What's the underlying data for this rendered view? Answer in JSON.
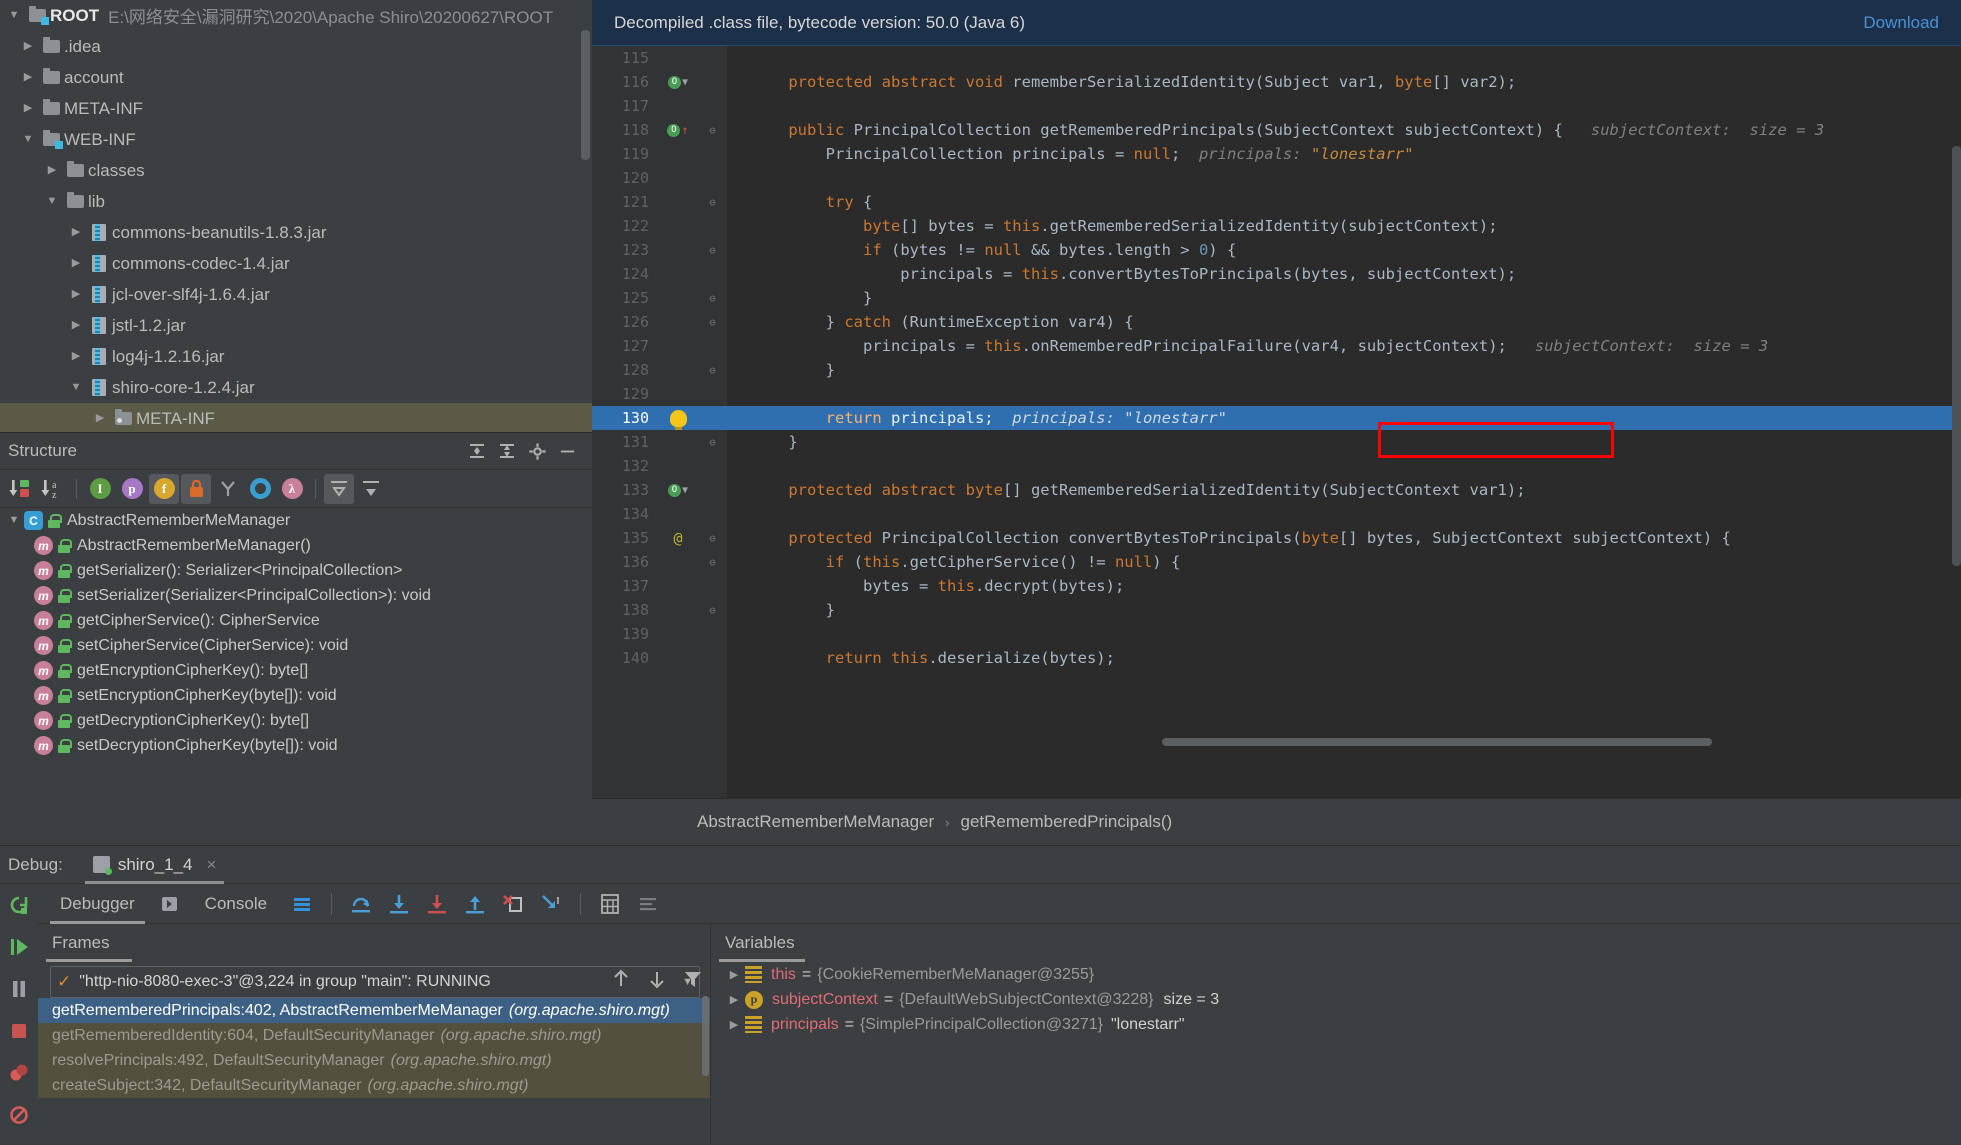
{
  "project_tree": {
    "root": {
      "label": "ROOT",
      "path": "E:\\网络安全\\漏洞研究\\2020\\Apache Shiro\\20200627\\ROOT"
    },
    "items": [
      {
        "label": ".idea",
        "indent": 1,
        "type": "folder",
        "expanded": false
      },
      {
        "label": "account",
        "indent": 1,
        "type": "folder",
        "expanded": false
      },
      {
        "label": "META-INF",
        "indent": 1,
        "type": "folder",
        "expanded": false
      },
      {
        "label": "WEB-INF",
        "indent": 1,
        "type": "folder-web",
        "expanded": true
      },
      {
        "label": "classes",
        "indent": 2,
        "type": "folder",
        "expanded": false
      },
      {
        "label": "lib",
        "indent": 2,
        "type": "folder",
        "expanded": true
      },
      {
        "label": "commons-beanutils-1.8.3.jar",
        "indent": 3,
        "type": "jar",
        "expanded": false
      },
      {
        "label": "commons-codec-1.4.jar",
        "indent": 3,
        "type": "jar",
        "expanded": false
      },
      {
        "label": "jcl-over-slf4j-1.6.4.jar",
        "indent": 3,
        "type": "jar",
        "expanded": false
      },
      {
        "label": "jstl-1.2.jar",
        "indent": 3,
        "type": "jar",
        "expanded": false
      },
      {
        "label": "log4j-1.2.16.jar",
        "indent": 3,
        "type": "jar",
        "expanded": false
      },
      {
        "label": "shiro-core-1.2.4.jar",
        "indent": 3,
        "type": "jar",
        "expanded": true
      },
      {
        "label": "META-INF",
        "indent": 4,
        "type": "folder-meta",
        "expanded": false,
        "selected": true
      }
    ]
  },
  "structure": {
    "title": "Structure",
    "header_buttons": [
      "expand-all-icon",
      "collapse-all-icon",
      "gear-icon",
      "hide-icon"
    ],
    "toolbar_icons": [
      {
        "name": "sort-by-visibility-icon",
        "glyph": "↓",
        "color": "#5fb85f"
      },
      {
        "name": "sort-alphabetically-icon",
        "glyph": "↓",
        "color": "#b0b0b0"
      },
      {
        "name": "show-inherited-icon",
        "glyph": "I",
        "color": "#5c9c43",
        "active": false
      },
      {
        "name": "show-properties-icon",
        "glyph": "p",
        "color": "#a678c6",
        "active": false
      },
      {
        "name": "show-fields-icon",
        "glyph": "f",
        "color": "#d9a62e",
        "active": true
      },
      {
        "name": "show-non-public-icon",
        "glyph": "■",
        "color": "#d96a28",
        "active": true
      },
      {
        "name": "group-methods-icon",
        "glyph": "Y",
        "color": "#9aa0a6",
        "active": false
      },
      {
        "name": "show-anonymous-icon",
        "glyph": "O",
        "color": "#3a9fd0",
        "active": false
      },
      {
        "name": "show-lambdas-icon",
        "glyph": "λ",
        "color": "#c87f9a",
        "active": false
      },
      {
        "name": "expand-all-icon",
        "glyph": "⤒",
        "color": "#b0b0b0",
        "active": true
      },
      {
        "name": "collapse-all-icon",
        "glyph": "⤓",
        "color": "#b0b0b0",
        "active": false
      }
    ],
    "items": [
      {
        "label": "AbstractRememberMeManager",
        "kind": "class",
        "level": 0
      },
      {
        "label": "AbstractRememberMeManager()",
        "kind": "method",
        "level": 1
      },
      {
        "label": "getSerializer(): Serializer<PrincipalCollection>",
        "kind": "method",
        "level": 1
      },
      {
        "label": "setSerializer(Serializer<PrincipalCollection>): void",
        "kind": "method",
        "level": 1
      },
      {
        "label": "getCipherService(): CipherService",
        "kind": "method",
        "level": 1
      },
      {
        "label": "setCipherService(CipherService): void",
        "kind": "method",
        "level": 1
      },
      {
        "label": "getEncryptionCipherKey(): byte[]",
        "kind": "method",
        "level": 1
      },
      {
        "label": "setEncryptionCipherKey(byte[]): void",
        "kind": "method",
        "level": 1
      },
      {
        "label": "getDecryptionCipherKey(): byte[]",
        "kind": "method",
        "level": 1
      },
      {
        "label": "setDecryptionCipherKey(byte[]): void",
        "kind": "method",
        "level": 1
      }
    ]
  },
  "editor": {
    "notification": {
      "text": "Decompiled .class file, bytecode version: 50.0 (Java 6)",
      "link": "Download"
    },
    "lines": [
      {
        "n": "115",
        "marker": "",
        "fold": "",
        "segments": []
      },
      {
        "n": "116",
        "marker": "breakpoint-down",
        "fold": "",
        "segments": [
          {
            "t": "    ",
            "c": "pl"
          },
          {
            "t": "protected abstract void ",
            "c": "kw"
          },
          {
            "t": "rememberSerializedIdentity(Subject var1, ",
            "c": "pl"
          },
          {
            "t": "byte",
            "c": "kw"
          },
          {
            "t": "[] var2);",
            "c": "pl"
          }
        ]
      },
      {
        "n": "117",
        "marker": "",
        "fold": "",
        "segments": []
      },
      {
        "n": "118",
        "marker": "breakpoint-up",
        "fold": "fold-open",
        "segments": [
          {
            "t": "    ",
            "c": "pl"
          },
          {
            "t": "public ",
            "c": "kw"
          },
          {
            "t": "PrincipalCollection getRememberedPrincipals(SubjectContext subjectContext) {",
            "c": "pl"
          },
          {
            "t": "   subjectContext:",
            "c": "hint"
          },
          {
            "t": "  size = 3",
            "c": "hint"
          }
        ]
      },
      {
        "n": "119",
        "marker": "",
        "fold": "",
        "segments": [
          {
            "t": "        PrincipalCollection principals = ",
            "c": "pl"
          },
          {
            "t": "null",
            "c": "kw"
          },
          {
            "t": ";",
            "c": "pl"
          },
          {
            "t": "  principals:",
            "c": "hint"
          },
          {
            "t": " \"lonestarr\"",
            "c": "hintv"
          }
        ]
      },
      {
        "n": "120",
        "marker": "",
        "fold": "",
        "segments": []
      },
      {
        "n": "121",
        "marker": "",
        "fold": "fold-open",
        "segments": [
          {
            "t": "        ",
            "c": "pl"
          },
          {
            "t": "try",
            "c": "kw"
          },
          {
            "t": " {",
            "c": "pl"
          }
        ]
      },
      {
        "n": "122",
        "marker": "",
        "fold": "",
        "segments": [
          {
            "t": "            ",
            "c": "pl"
          },
          {
            "t": "byte",
            "c": "kw"
          },
          {
            "t": "[] bytes = ",
            "c": "pl"
          },
          {
            "t": "this",
            "c": "kw"
          },
          {
            "t": ".getRememberedSerializedIdentity(subjectContext);",
            "c": "pl"
          }
        ]
      },
      {
        "n": "123",
        "marker": "",
        "fold": "fold-open",
        "segments": [
          {
            "t": "            ",
            "c": "pl"
          },
          {
            "t": "if",
            "c": "kw"
          },
          {
            "t": " (bytes != ",
            "c": "pl"
          },
          {
            "t": "null",
            "c": "kw"
          },
          {
            "t": " && bytes.length > ",
            "c": "pl"
          },
          {
            "t": "0",
            "c": "num"
          },
          {
            "t": ") {",
            "c": "pl"
          }
        ]
      },
      {
        "n": "124",
        "marker": "",
        "fold": "",
        "segments": [
          {
            "t": "                principals = ",
            "c": "pl"
          },
          {
            "t": "this",
            "c": "kw"
          },
          {
            "t": ".convertBytesToPrincipals(bytes, subjectContext);",
            "c": "pl"
          }
        ]
      },
      {
        "n": "125",
        "marker": "",
        "fold": "fold-close",
        "segments": [
          {
            "t": "            }",
            "c": "pl"
          }
        ]
      },
      {
        "n": "126",
        "marker": "",
        "fold": "fold-open",
        "segments": [
          {
            "t": "        } ",
            "c": "pl"
          },
          {
            "t": "catch",
            "c": "kw"
          },
          {
            "t": " (RuntimeException var4) {",
            "c": "pl"
          }
        ]
      },
      {
        "n": "127",
        "marker": "",
        "fold": "",
        "segments": [
          {
            "t": "            principals = ",
            "c": "pl"
          },
          {
            "t": "this",
            "c": "kw"
          },
          {
            "t": ".onRememberedPrincipalFailure(var4, subjectContext);",
            "c": "pl"
          },
          {
            "t": "   subjectContext:",
            "c": "hint"
          },
          {
            "t": "  size = 3",
            "c": "hint"
          }
        ]
      },
      {
        "n": "128",
        "marker": "",
        "fold": "fold-close",
        "segments": [
          {
            "t": "        }",
            "c": "pl"
          }
        ]
      },
      {
        "n": "129",
        "marker": "",
        "fold": "",
        "segments": []
      },
      {
        "n": "130",
        "marker": "bulb",
        "fold": "",
        "highlight": true,
        "segments": [
          {
            "t": "        ",
            "c": "pl"
          },
          {
            "t": "return",
            "c": "kw"
          },
          {
            "t": " principals;",
            "c": "pl"
          },
          {
            "t": "  principals:",
            "c": "hint"
          },
          {
            "t": " \"lonestarr\"",
            "c": "hintv"
          }
        ]
      },
      {
        "n": "131",
        "marker": "",
        "fold": "fold-close",
        "segments": [
          {
            "t": "    }",
            "c": "pl"
          }
        ]
      },
      {
        "n": "132",
        "marker": "",
        "fold": "",
        "segments": []
      },
      {
        "n": "133",
        "marker": "breakpoint-down",
        "fold": "",
        "segments": [
          {
            "t": "    ",
            "c": "pl"
          },
          {
            "t": "protected abstract byte",
            "c": "kw"
          },
          {
            "t": "[] getRememberedSerializedIdentity(SubjectContext var1);",
            "c": "pl"
          }
        ]
      },
      {
        "n": "134",
        "marker": "",
        "fold": "",
        "segments": []
      },
      {
        "n": "135",
        "marker": "at",
        "fold": "fold-open",
        "segments": [
          {
            "t": "    ",
            "c": "pl"
          },
          {
            "t": "protected ",
            "c": "kw"
          },
          {
            "t": "PrincipalCollection convertBytesToPrincipals(",
            "c": "pl"
          },
          {
            "t": "byte",
            "c": "kw"
          },
          {
            "t": "[] bytes, SubjectContext subjectContext) {",
            "c": "pl"
          }
        ]
      },
      {
        "n": "136",
        "marker": "",
        "fold": "fold-open",
        "segments": [
          {
            "t": "        ",
            "c": "pl"
          },
          {
            "t": "if",
            "c": "kw"
          },
          {
            "t": " (",
            "c": "pl"
          },
          {
            "t": "this",
            "c": "kw"
          },
          {
            "t": ".getCipherService() != ",
            "c": "pl"
          },
          {
            "t": "null",
            "c": "kw"
          },
          {
            "t": ") {",
            "c": "pl"
          }
        ]
      },
      {
        "n": "137",
        "marker": "",
        "fold": "",
        "segments": [
          {
            "t": "            bytes = ",
            "c": "pl"
          },
          {
            "t": "this",
            "c": "kw"
          },
          {
            "t": ".decrypt(bytes);",
            "c": "pl"
          }
        ]
      },
      {
        "n": "138",
        "marker": "",
        "fold": "fold-close",
        "segments": [
          {
            "t": "        }",
            "c": "pl"
          }
        ]
      },
      {
        "n": "139",
        "marker": "",
        "fold": "",
        "segments": []
      },
      {
        "n": "140",
        "marker": "",
        "fold": "",
        "segments": [
          {
            "t": "        ",
            "c": "pl"
          },
          {
            "t": "return",
            "c": "kw"
          },
          {
            "t": " ",
            "c": "pl"
          },
          {
            "t": "this",
            "c": "kw"
          },
          {
            "t": ".deserialize(bytes);",
            "c": "pl"
          }
        ]
      }
    ],
    "breadcrumb": {
      "class": "AbstractRememberMeManager",
      "method": "getRememberedPrincipals()"
    },
    "annotation": {
      "name": "red-highlight-box",
      "color": "#ff0000"
    }
  },
  "debug": {
    "label": "Debug:",
    "session_tab": "shiro_1_4",
    "close_glyph": "×",
    "tabs": [
      {
        "label": "Debugger",
        "selected": true
      },
      {
        "label": "Console",
        "selected": false
      }
    ],
    "toolbar_icons": [
      {
        "name": "show-execution-point-icon",
        "glyph": "≡",
        "color": "#3592e0"
      },
      {
        "name": "step-over-icon",
        "glyph": "⤴",
        "color": "#4a9fd6"
      },
      {
        "name": "step-into-icon",
        "glyph": "↓",
        "color": "#4a9fd6"
      },
      {
        "name": "force-step-into-icon",
        "glyph": "↓",
        "color": "#d05050"
      },
      {
        "name": "step-out-icon",
        "glyph": "↑",
        "color": "#4a9fd6"
      },
      {
        "name": "drop-frame-icon",
        "glyph": "✕",
        "color": "#d05050"
      },
      {
        "name": "run-to-cursor-icon",
        "glyph": "↘",
        "color": "#4a9fd6"
      },
      {
        "name": "evaluate-expression-icon",
        "glyph": "⊞",
        "color": "#b0b0b0"
      },
      {
        "name": "settings-icon",
        "glyph": "≣",
        "color": "#7a7d7f"
      }
    ],
    "rail_icons": [
      {
        "name": "rerun-icon",
        "glyph": "↻",
        "color": "#5fb85f"
      },
      {
        "name": "resume-program-icon",
        "glyph": "▶",
        "color": "#5fb85f"
      },
      {
        "name": "pause-program-icon",
        "glyph": "‖",
        "color": "#9aa0a6"
      },
      {
        "name": "stop-icon",
        "glyph": "■",
        "color": "#c75450"
      },
      {
        "name": "view-breakpoints-icon",
        "glyph": "●",
        "color": "#d65c5c"
      },
      {
        "name": "mute-breakpoints-icon",
        "glyph": "⊘",
        "color": "#d65c5c"
      }
    ],
    "frames": {
      "title": "Frames",
      "thread": "\"http-nio-8080-exec-3\"@3,224 in group \"main\": RUNNING",
      "side_icons": [
        {
          "name": "move-up-icon",
          "glyph": "↑"
        },
        {
          "name": "move-down-icon",
          "glyph": "↓"
        },
        {
          "name": "filter-icon",
          "glyph": "▼"
        }
      ],
      "items": [
        {
          "method": "getRememberedPrincipals:402, AbstractRememberMeManager",
          "pkg": "(org.apache.shiro.mgt)",
          "selected": true
        },
        {
          "method": "getRememberedIdentity:604, DefaultSecurityManager",
          "pkg": "(org.apache.shiro.mgt)",
          "selected": false
        },
        {
          "method": "resolvePrincipals:492, DefaultSecurityManager",
          "pkg": "(org.apache.shiro.mgt)",
          "selected": false
        },
        {
          "method": "createSubject:342, DefaultSecurityManager",
          "pkg": "(org.apache.shiro.mgt)",
          "selected": false
        }
      ]
    },
    "variables": {
      "title": "Variables",
      "items": [
        {
          "icon": "list-icon",
          "name": "this",
          "value": "{CookieRememberMeManager@3255}",
          "extra": ""
        },
        {
          "icon": "param-icon",
          "name": "subjectContext",
          "value": "{DefaultWebSubjectContext@3228}",
          "extra": "size = 3"
        },
        {
          "icon": "list-icon",
          "name": "principals",
          "value": "{SimplePrincipalCollection@3271}",
          "str": "\"lonestarr\""
        }
      ]
    }
  }
}
